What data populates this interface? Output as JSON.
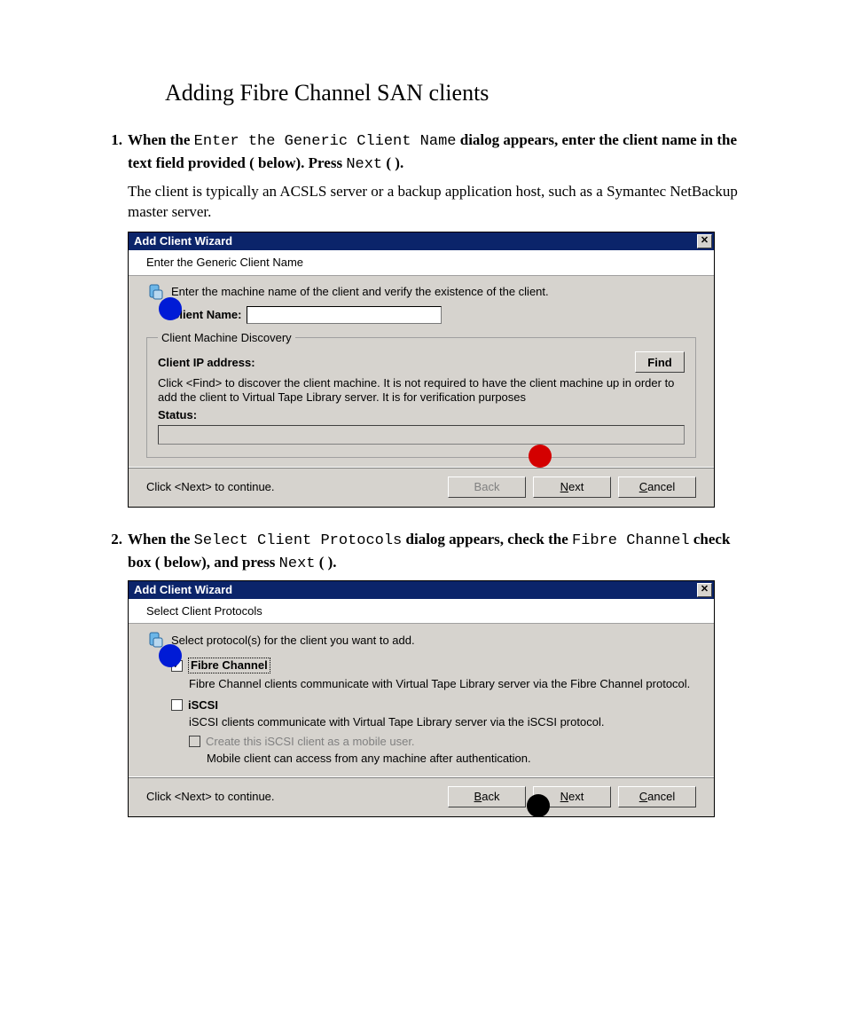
{
  "page": {
    "heading": "Adding Fibre Channel SAN clients"
  },
  "step1": {
    "num": "1.",
    "pre": "When the ",
    "code1": "Enter the Generic Client Name",
    "mid1": " dialog appears, enter the client name in the text field provided (",
    "mid2": " below). Press ",
    "code2": "Next",
    "end": " ( ).",
    "note": "The client is typically an ACSLS server or a backup application host, such as a Symantec NetBackup master server."
  },
  "wiz1": {
    "title": "Add Client Wizard",
    "subhead": "Enter the Generic Client Name",
    "intro": "Enter the machine name of the client and verify the existence of the client.",
    "clientNameLabel": "Client Name:",
    "clientNameValue": "",
    "groupLegend": "Client Machine Discovery",
    "ipLabel": "Client IP address:",
    "findBtn": "Find",
    "helpText": "Click <Find> to discover the client machine. It is not required to have the client machine up in order to add the client to Virtual Tape Library server. It is for verification purposes",
    "statusLabel": "Status:",
    "footerNote": "Click <Next> to continue.",
    "backBtn": "Back",
    "nextPre": "N",
    "nextRest": "ext",
    "cancelPre": "C",
    "cancelRest": "ancel"
  },
  "step2": {
    "num": "2.",
    "pre": "When the ",
    "code1": "Select Client Protocols",
    "mid1": " dialog appears, check the ",
    "code2": "Fibre Channel",
    "mid2": " check box  (",
    "mid3": " below), and press ",
    "code3": "Next",
    "end": " ( )."
  },
  "wiz2": {
    "title": "Add Client Wizard",
    "subhead": "Select Client Protocols",
    "intro": "Select protocol(s) for the client you want to add.",
    "fcLabel": "Fibre Channel",
    "fcDesc": "Fibre Channel clients communicate with Virtual Tape Library server via the Fibre Channel protocol.",
    "iscsiLabel": "iSCSI",
    "iscsiDesc": "iSCSI clients communicate with Virtual Tape Library server via the iSCSI protocol.",
    "mobileLabel": "Create this iSCSI client as a mobile user.",
    "mobileDesc": "Mobile client can access from any machine after authentication.",
    "footerNote": "Click <Next> to continue.",
    "backPre": "B",
    "backRest": "ack",
    "nextPre": "N",
    "nextRest": "ext",
    "cancelPre": "C",
    "cancelRest": "ancel"
  }
}
